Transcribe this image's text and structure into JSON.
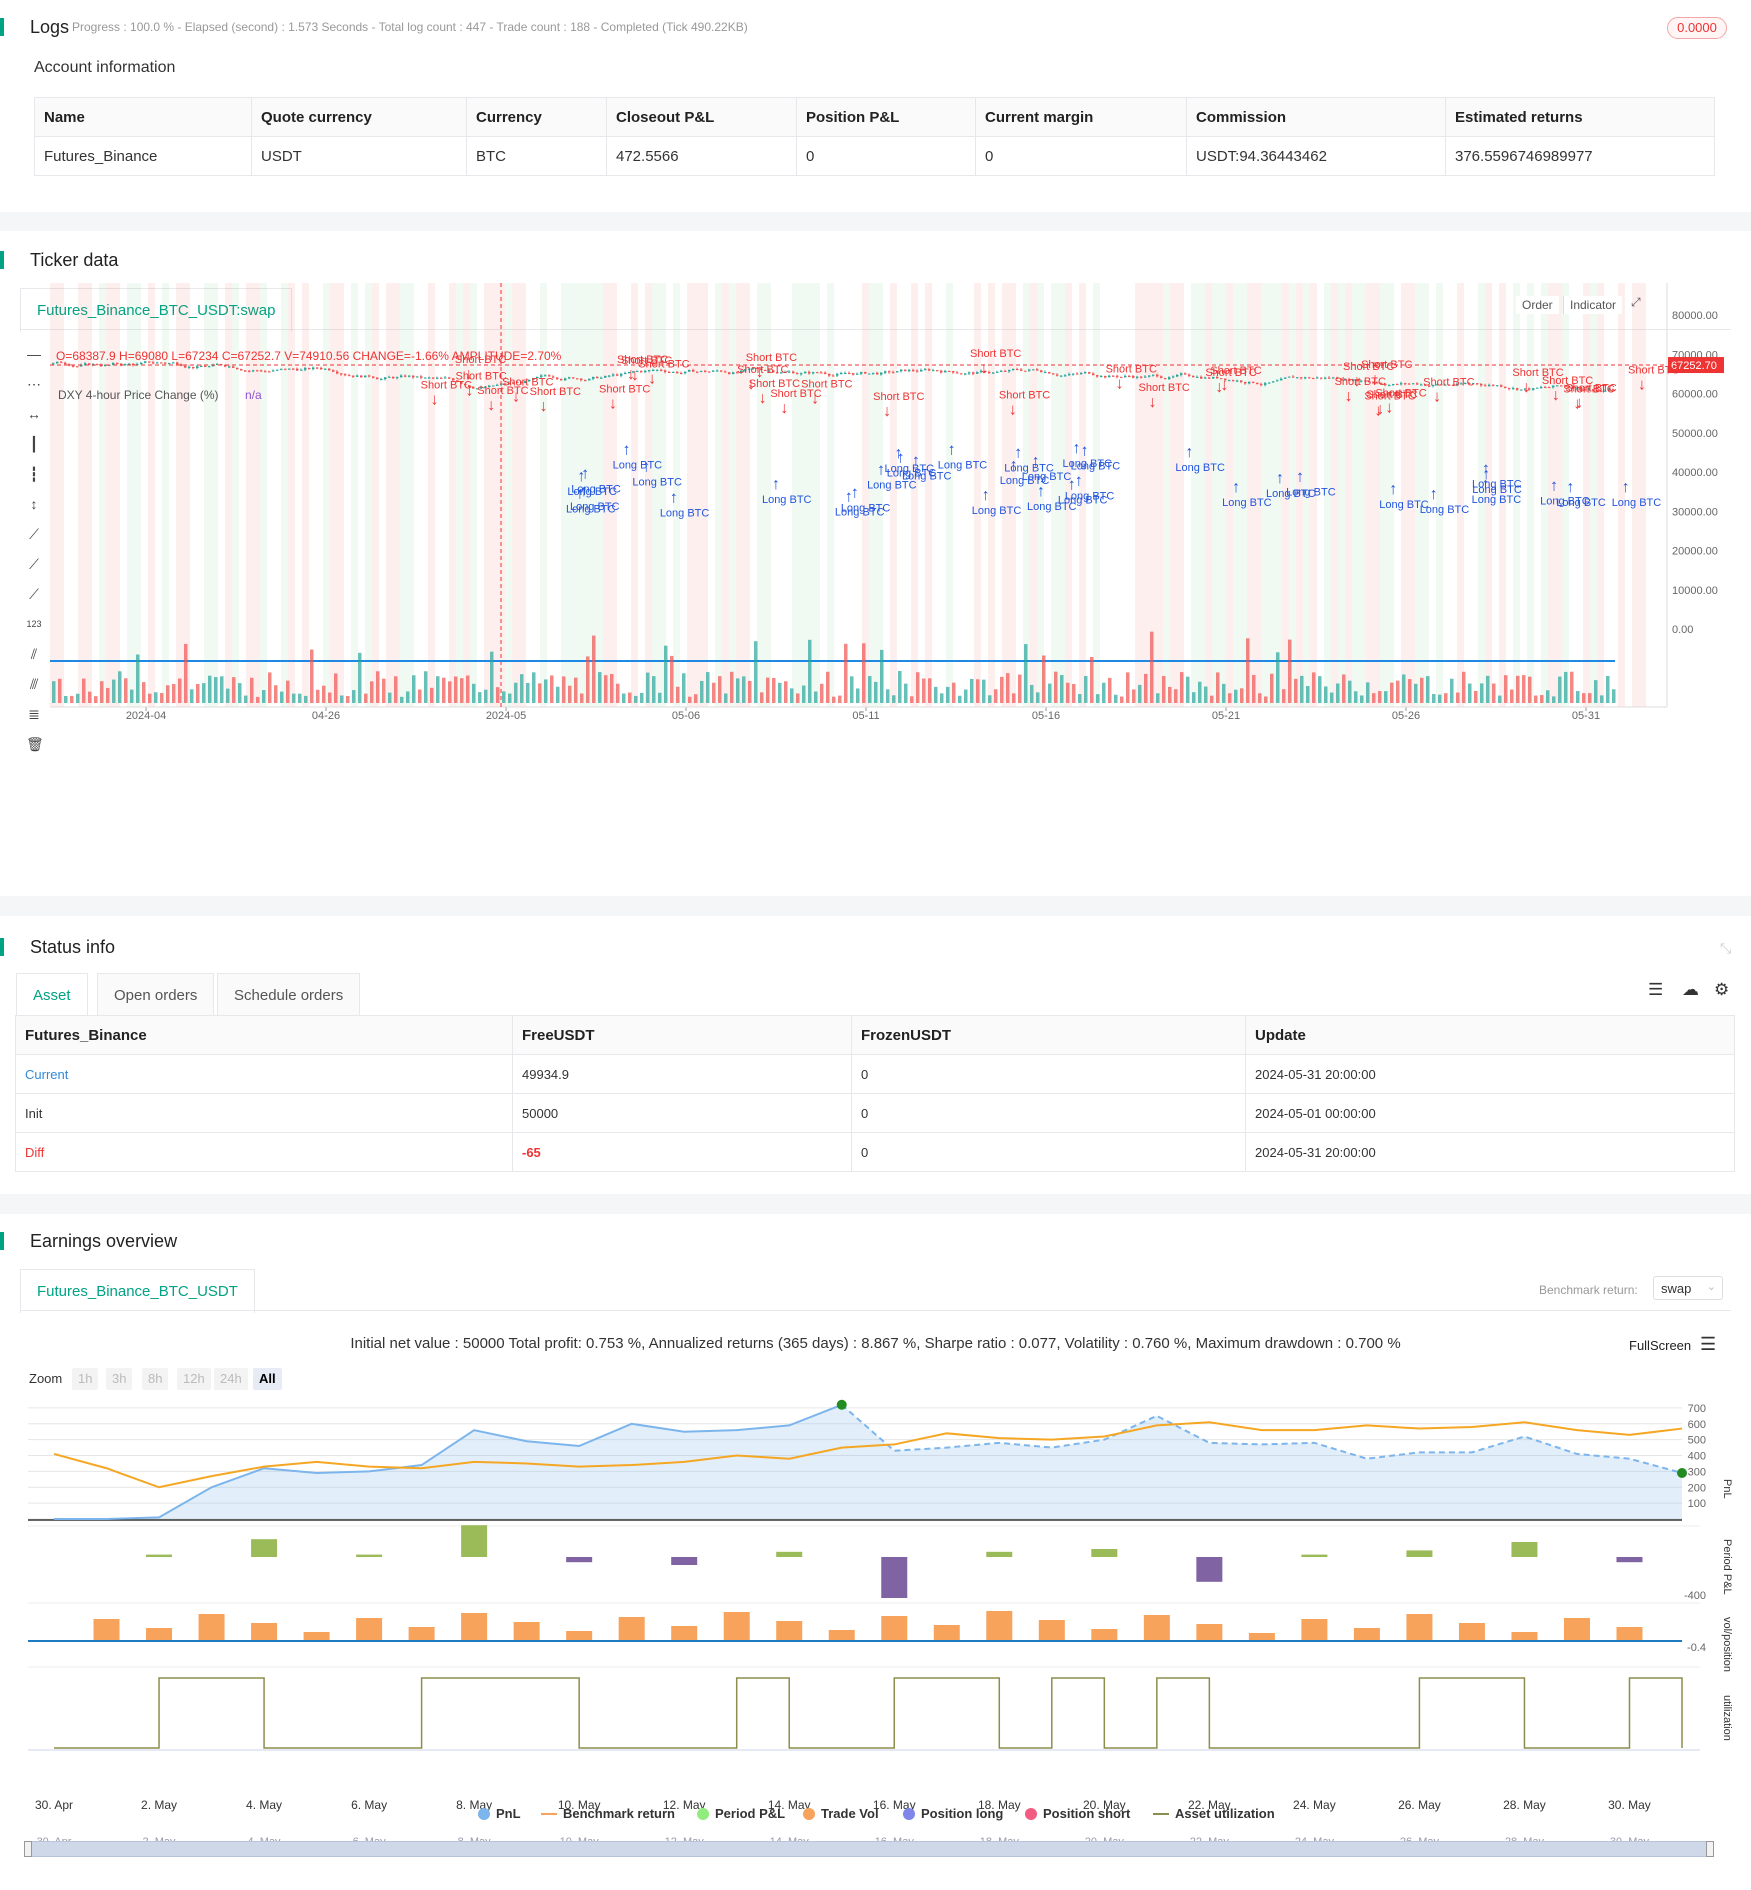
{
  "logs": {
    "title": "Logs",
    "progress": "Progress : 100.0 % - Elapsed (second) : 1.573  Seconds - Total log count : 447 - Trade count : 188 - Completed (Tick 490.22KB)",
    "badge": "0.0000"
  },
  "account": {
    "title": "Account information",
    "headers": [
      "Name",
      "Quote currency",
      "Currency",
      "Closeout P&L",
      "Position P&L",
      "Current margin",
      "Commission",
      "Estimated returns"
    ],
    "row": [
      "Futures_Binance",
      "USDT",
      "BTC",
      "472.5566",
      "0",
      "0",
      "USDT:94.36443462",
      "376.5596746989977"
    ]
  },
  "ticker": {
    "title": "Ticker data",
    "tab": "Futures_Binance_BTC_USDT:swap",
    "ohlc": "O=68387.9 H=69080 L=67234 C=67252.7 V=74910.56 CHANGE=-1.66% AMPLITUDE=2.70%",
    "indicator_name": "DXY 4-hour Price Change (%)",
    "indicator_value": "n/a",
    "btn_order": "Order",
    "btn_indicator": "Indicator",
    "price_label": "67252.70",
    "y_ticks": [
      "80000.00",
      "70000.00",
      "60000.00",
      "50000.00",
      "40000.00",
      "30000.00",
      "20000.00",
      "10000.00",
      "0.00"
    ],
    "x_ticks": [
      "2024-04",
      "04-26",
      "2024-05",
      "05-06",
      "05-11",
      "05-16",
      "05-21",
      "05-26",
      "05-31"
    ],
    "trade_labels": {
      "long": "Long BTC",
      "short": "Short BTC"
    }
  },
  "status": {
    "title": "Status info",
    "tabs": [
      "Asset",
      "Open orders",
      "Schedule orders"
    ],
    "headers": [
      "Futures_Binance",
      "FreeUSDT",
      "FrozenUSDT",
      "Update"
    ],
    "rows": [
      [
        "Current",
        "49934.9",
        "0",
        "2024-05-31 20:00:00"
      ],
      [
        "Init",
        "50000",
        "0",
        "2024-05-01 00:00:00"
      ],
      [
        "Diff",
        "-65",
        "0",
        "2024-05-31 20:00:00"
      ]
    ]
  },
  "earnings": {
    "title": "Earnings overview",
    "tab": "Futures_Binance_BTC_USDT",
    "benchmark_label": "Benchmark return:",
    "benchmark_value": "swap",
    "summary": "Initial net value : 50000 Total profit: 0.753 %, Annualized returns (365 days) : 8.867 %, Sharpe ratio : 0.077, Volatility : 0.760 %, Maximum drawdown : 0.700 %",
    "fullscreen": "FullScreen",
    "zoom_label": "Zoom",
    "zoom_options": [
      "1h",
      "3h",
      "8h",
      "12h",
      "24h",
      "All"
    ],
    "pnl_ticks": [
      "700",
      "600",
      "500",
      "400",
      "300",
      "200",
      "100"
    ],
    "axis_labels": [
      "PnL",
      "Period P&L",
      "vol/position",
      "utilization"
    ],
    "period_tick": "-400",
    "vol_tick": "-0.4",
    "x_ticks": [
      "30. Apr",
      "2. May",
      "4. May",
      "6. May",
      "8. May",
      "10. May",
      "12. May",
      "14. May",
      "16. May",
      "18. May",
      "20. May",
      "22. May",
      "24. May",
      "26. May",
      "28. May",
      "30. May"
    ],
    "legend": [
      {
        "label": "PnL",
        "color": "#7cb5ec"
      },
      {
        "label": "Benchmark return",
        "color": "#f7a35c"
      },
      {
        "label": "Period P&L",
        "color": "#90ed7d"
      },
      {
        "label": "Trade Vol",
        "color": "#f7a35c"
      },
      {
        "label": "Position long",
        "color": "#8085e9"
      },
      {
        "label": "Position short",
        "color": "#f15c80"
      },
      {
        "label": "Asset utilization",
        "color": "#8d8d4d"
      }
    ],
    "chart_data": {
      "type": "line",
      "x": [
        "30. Apr",
        "1. May",
        "2. May",
        "3. May",
        "4. May",
        "5. May",
        "6. May",
        "7. May",
        "8. May",
        "9. May",
        "10. May",
        "11. May",
        "12. May",
        "13. May",
        "14. May",
        "15. May",
        "16. May",
        "17. May",
        "18. May",
        "19. May",
        "20. May",
        "21. May",
        "22. May",
        "23. May",
        "24. May",
        "25. May",
        "26. May",
        "27. May",
        "28. May",
        "29. May",
        "30. May",
        "31. May"
      ],
      "series": [
        {
          "name": "PnL",
          "values": [
            0,
            0,
            10,
            200,
            320,
            290,
            300,
            340,
            560,
            490,
            460,
            600,
            550,
            560,
            590,
            720,
            430,
            450,
            480,
            450,
            500,
            650,
            480,
            470,
            480,
            380,
            420,
            420,
            520,
            410,
            380,
            290
          ]
        },
        {
          "name": "Benchmark return",
          "values": [
            410,
            320,
            200,
            270,
            330,
            360,
            330,
            320,
            360,
            350,
            330,
            340,
            360,
            400,
            380,
            450,
            470,
            540,
            510,
            500,
            520,
            590,
            610,
            560,
            560,
            590,
            570,
            580,
            610,
            560,
            530,
            570
          ]
        }
      ],
      "ylim": [
        0,
        750
      ]
    }
  }
}
